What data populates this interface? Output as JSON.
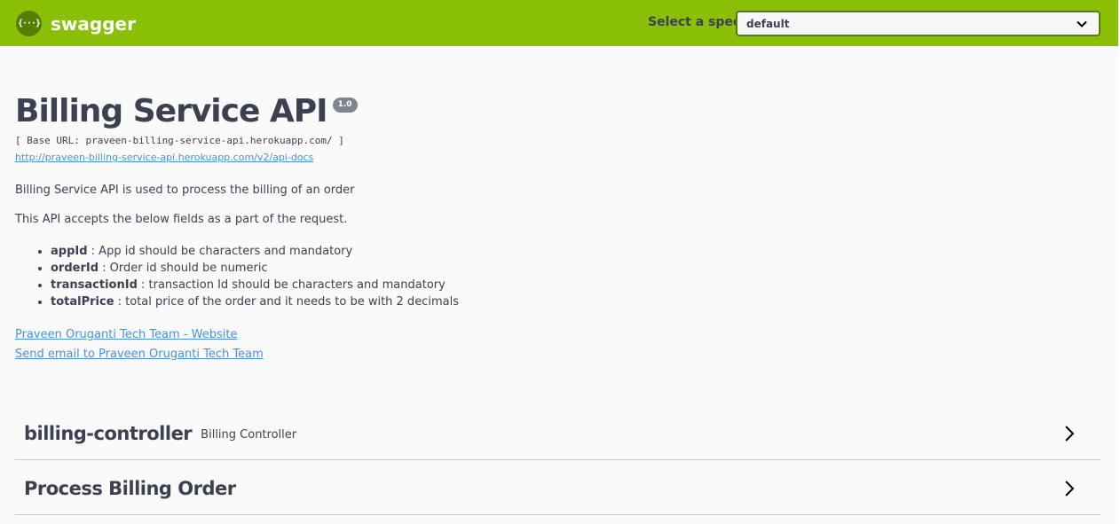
{
  "topbar": {
    "logo_glyph": "{···}",
    "logo_text": "swagger",
    "spec_label": "Select a spec",
    "spec_selected": "default",
    "bg_color": "#89bf04"
  },
  "info": {
    "title": "Billing Service API",
    "version": "1.0",
    "base_url": "[ Base URL: praveen-billing-service-api.herokuapp.com/ ]",
    "docs_url": "http://praveen-billing-service-api.herokuapp.com/v2/api-docs",
    "description": "Billing Service API is used to process the billing of an order",
    "description2": "This API accepts the below fields as a part of the request.",
    "fields": [
      {
        "name": "appId",
        "text": " : App id should be characters and mandatory"
      },
      {
        "name": "orderId",
        "text": " : Order id should be numeric"
      },
      {
        "name": "transactionId",
        "text": " : transaction Id should be characters and mandatory"
      },
      {
        "name": "totalPrice",
        "text": " : total price of the order and it needs to be with 2 decimals"
      }
    ],
    "contact_website": "Praveen Oruganti Tech Team - Website",
    "contact_email": "Send email to Praveen Oruganti Tech Team"
  },
  "tags": [
    {
      "name": "billing-controller",
      "description": "Billing Controller"
    },
    {
      "name": "Process Billing Order",
      "description": ""
    }
  ]
}
